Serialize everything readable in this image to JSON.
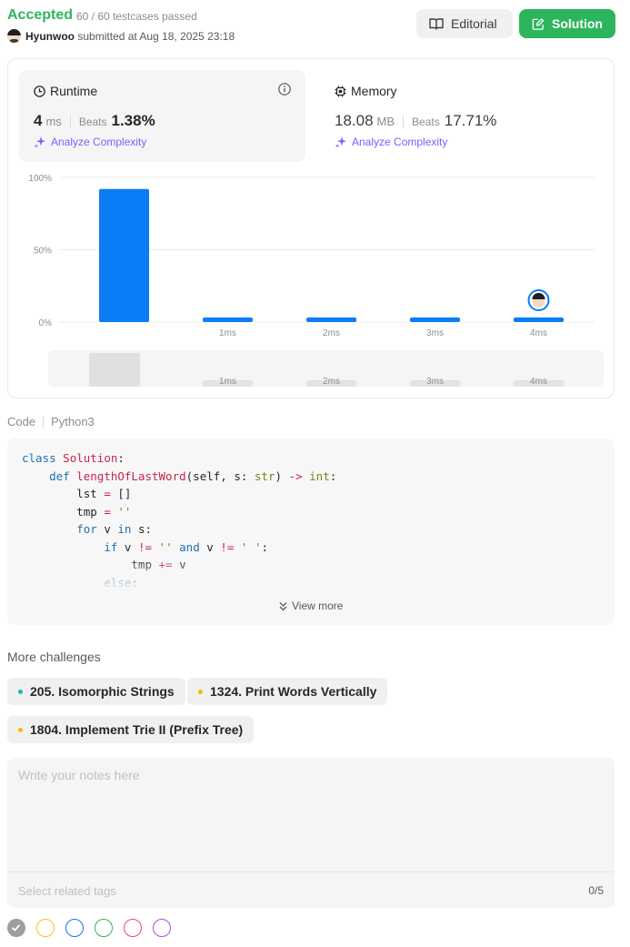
{
  "header": {
    "status": "Accepted",
    "testcases": "60 / 60 testcases passed",
    "username": "Hyunwoo",
    "submitted_at": "submitted at Aug 18, 2025 23:18",
    "editorial_label": "Editorial",
    "solution_label": "Solution"
  },
  "runtime": {
    "title": "Runtime",
    "value": "4",
    "unit": "ms",
    "beats_label": "Beats",
    "beats": "1.38%",
    "analyze": "Analyze Complexity"
  },
  "memory": {
    "title": "Memory",
    "value": "18.08",
    "unit": "MB",
    "beats_label": "Beats",
    "beats": "17.71%",
    "analyze": "Analyze Complexity"
  },
  "chart_data": {
    "type": "bar",
    "categories": [
      "",
      "1ms",
      "2ms",
      "3ms",
      "4ms"
    ],
    "values": [
      92,
      2,
      2,
      2,
      2
    ],
    "ylim": [
      0,
      100
    ],
    "yticks": [
      "100%",
      "50%",
      "0%"
    ],
    "highlight_category": "4ms",
    "grid": true
  },
  "code": {
    "label": "Code",
    "language": "Python3",
    "view_more": "View more"
  },
  "more_challenges": {
    "title": "More challenges",
    "items": [
      {
        "label": "205. Isomorphic Strings",
        "color": "#1cb8a8"
      },
      {
        "label": "1324. Print Words Vertically",
        "color": "#ffb700"
      },
      {
        "label": "1804. Implement Trie II (Prefix Tree)",
        "color": "#ffb700"
      }
    ]
  },
  "notes": {
    "placeholder": "Write your notes here",
    "tags_placeholder": "Select related tags",
    "count": "0/5"
  },
  "note_colors": [
    "#9e9e9e",
    "#ffc01e",
    "#1a73e8",
    "#2db55d",
    "#ef4774",
    "#b44fd6"
  ]
}
